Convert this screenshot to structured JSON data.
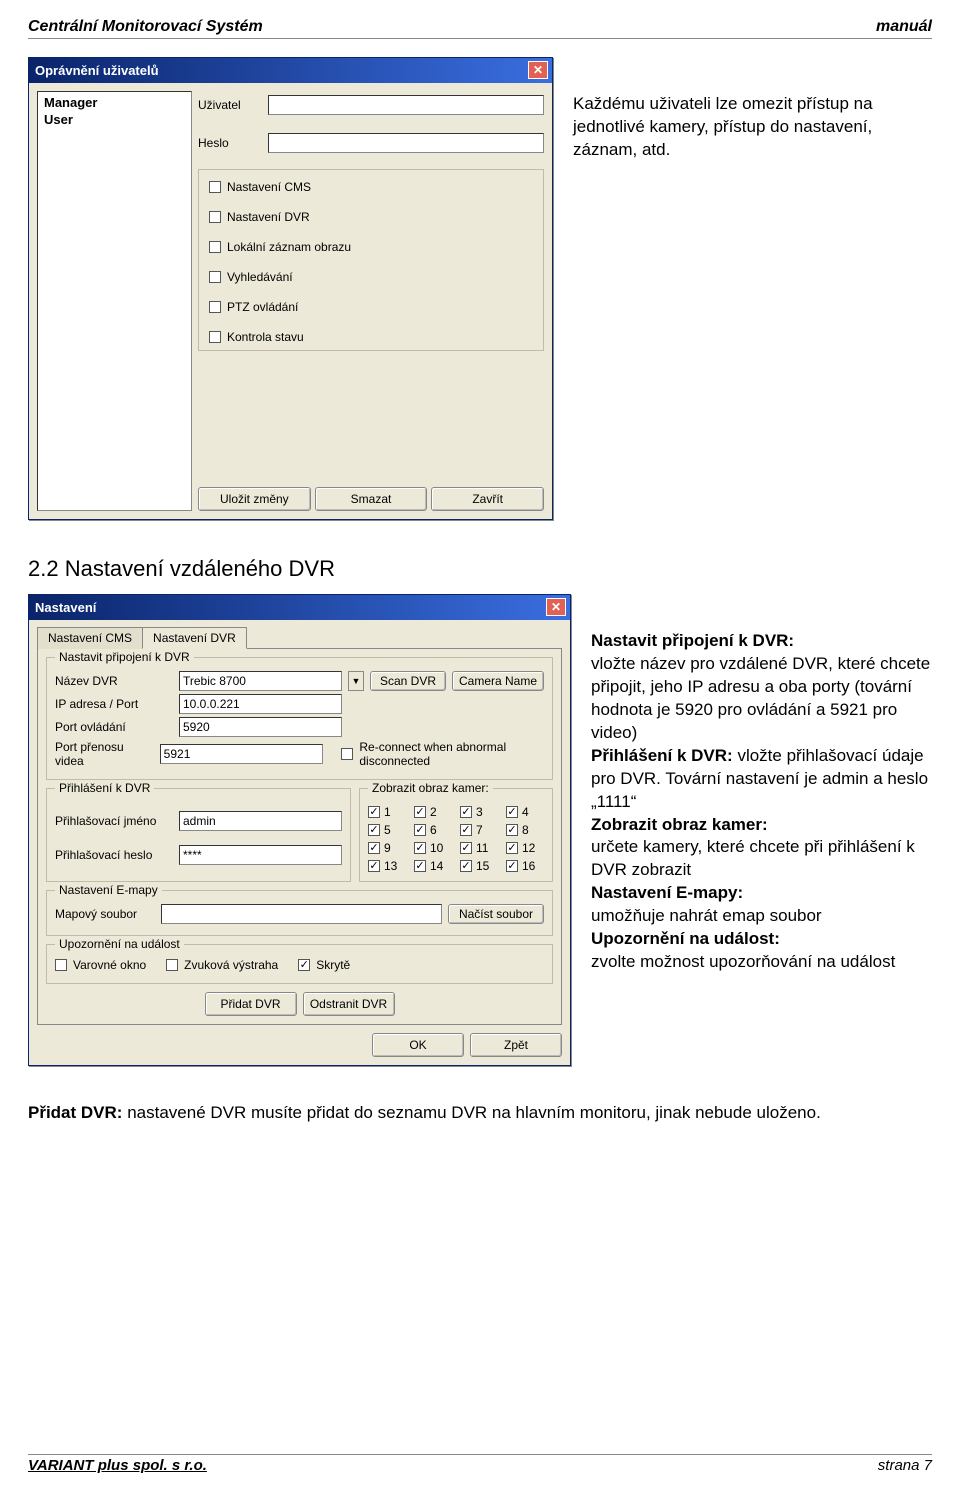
{
  "header": {
    "left": "Centrální Monitorovací Systém",
    "right": "manuál"
  },
  "footer": {
    "left": "VARIANT plus spol. s r.o.",
    "right": "strana 7"
  },
  "intro_para": "Každému uživateli lze omezit přístup na jednotlivé kamery, přístup do nastavení, záznam, atd.",
  "section2_title": "2.2 Nastavení vzdáleného DVR",
  "dlg1": {
    "title": "Oprávnění uživatelů",
    "users": [
      "Manager",
      "User"
    ],
    "fields": {
      "user_label": "Uživatel",
      "pass_label": "Heslo"
    },
    "checks": [
      "Nastavení CMS",
      "Nastavení DVR",
      "Lokální záznam obrazu",
      "Vyhledávání",
      "PTZ ovládání",
      "Kontrola stavu"
    ],
    "buttons": {
      "save": "Uložit změny",
      "delete": "Smazat",
      "close": "Zavřít"
    }
  },
  "dlg2": {
    "title": "Nastavení",
    "tabs": [
      "Nastavení CMS",
      "Nastavení DVR"
    ],
    "g_connect": {
      "label": "Nastavit připojení k DVR",
      "name_label": "Název DVR",
      "name_value": "Trebic 8700",
      "scan_btn": "Scan DVR",
      "cam_btn": "Camera Name",
      "ip_label": "IP adresa / Port",
      "ip_value": "10.0.0.221",
      "ctrl_label": "Port ovládání",
      "ctrl_value": "5920",
      "vid_label": "Port přenosu videa",
      "vid_value": "5921",
      "reconnect": "Re-connect when abnormal disconnected"
    },
    "g_login": {
      "label_left": "Přihlášení k DVR",
      "label_right": "Zobrazit obraz kamer:",
      "user_label": "Přihlašovací jméno",
      "user_value": "admin",
      "pass_label": "Přihlašovací heslo",
      "pass_value": "****",
      "cams": [
        "1",
        "2",
        "3",
        "4",
        "5",
        "6",
        "7",
        "8",
        "9",
        "10",
        "11",
        "12",
        "13",
        "14",
        "15",
        "16"
      ]
    },
    "g_emap": {
      "label": "Nastavení E-mapy",
      "file_label": "Mapový soubor",
      "load_btn": "Načíst soubor"
    },
    "g_alert": {
      "label": "Upozornění na událost",
      "warn": "Varovné okno",
      "sound": "Zvuková výstraha",
      "hidden": "Skrytě"
    },
    "btns": {
      "add": "Přidat DVR",
      "del": "Odstranit DVR",
      "ok": "OK",
      "back": "Zpět"
    }
  },
  "desc2": {
    "t1": "Nastavit připojení k DVR:",
    "p1": "vložte název pro vzdálené DVR, které chcete připojit, jeho IP adresu a oba porty (tovární hodnota je 5920 pro ovládání a 5921 pro video)",
    "t2": "Přihlášení k DVR:",
    "p2": " vložte přihlašovací údaje pro DVR. Tovární nastavení je admin a heslo „1111“",
    "t3": "Zobrazit obraz kamer:",
    "p3": "určete kamery, které chcete při přihlášení k DVR zobrazit",
    "t4": "Nastavení E-mapy:",
    "p4": "umožňuje nahrát emap soubor",
    "t5": "Upozornění na událost:",
    "p5": "zvolte možnost upozorňová­ní na událost"
  },
  "para_after": {
    "b": "Přidat DVR:",
    "t": " nastavené DVR musíte přidat do seznamu DVR na hlavním monito­ru, jinak nebude uloženo."
  }
}
